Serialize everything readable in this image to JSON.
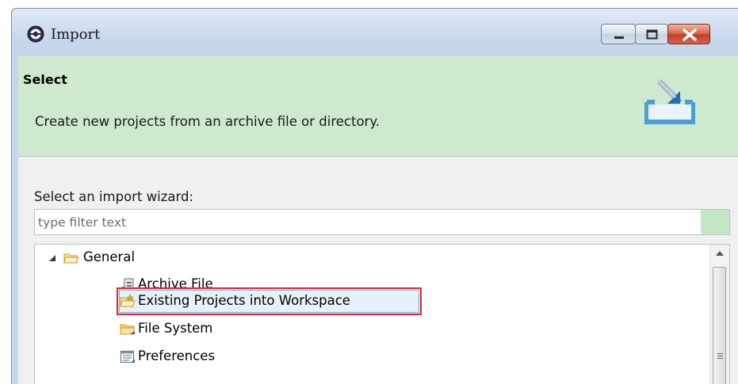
{
  "window": {
    "title": "Import",
    "controls": [
      "minimize-icon",
      "maximize-icon",
      "close-icon"
    ],
    "close_color": "#c2402a"
  },
  "header": {
    "title": "Select",
    "description": "Create new projects from an archive file or directory.",
    "background": "#cfe9cf",
    "icon": "import-tray-icon"
  },
  "wizard": {
    "label": "Select an import wizard:",
    "filter_placeholder": "type filter text",
    "filter_value": "",
    "tree": [
      {
        "label": "General",
        "icon": "folder-open-icon",
        "expanded": true,
        "level": 0
      },
      {
        "label": "Archive File",
        "icon": "archive-file-icon",
        "level": 1
      },
      {
        "label": "Existing Projects into Workspace",
        "icon": "existing-projects-icon",
        "level": 1,
        "selected": true
      },
      {
        "label": "File System",
        "icon": "file-system-folder-icon",
        "level": 1
      },
      {
        "label": "Preferences",
        "icon": "preferences-icon",
        "level": 1
      }
    ],
    "highlight_color": "#e0282b"
  }
}
